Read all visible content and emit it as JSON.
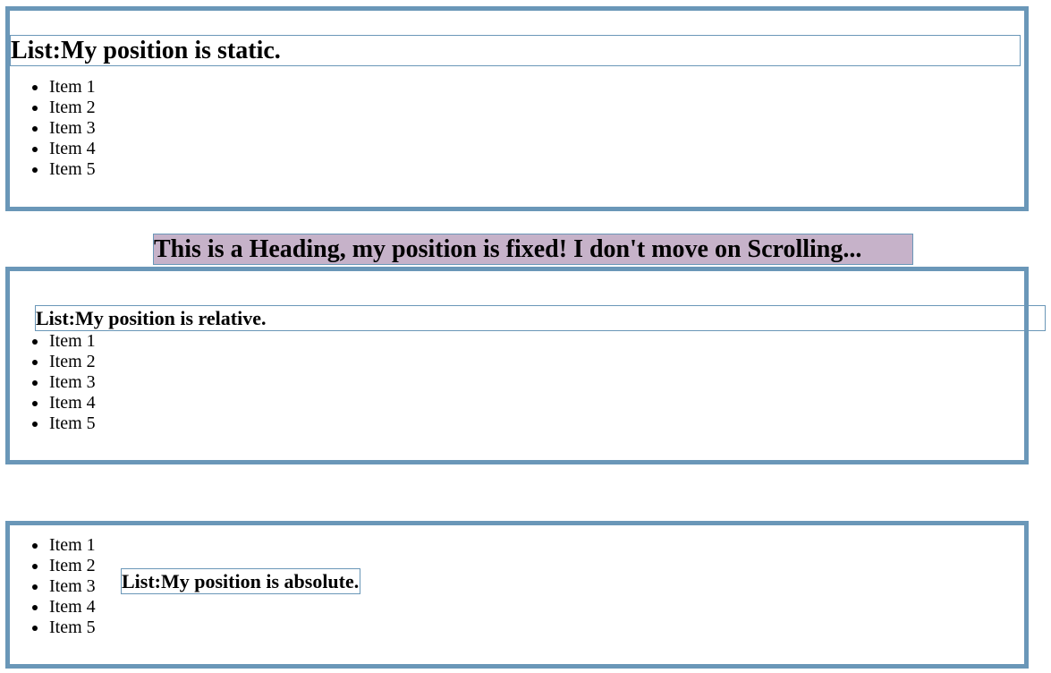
{
  "fixed_heading": "This is a Heading, my position is fixed! I don't move on Scrolling...",
  "sections": [
    {
      "heading": "List:My position is static.",
      "items": [
        "Item 1",
        "Item 2",
        "Item 3",
        "Item 4",
        "Item 5"
      ]
    },
    {
      "heading": "List:My position is relative.",
      "items": [
        "Item 1",
        "Item 2",
        "Item 3",
        "Item 4",
        "Item 5"
      ]
    },
    {
      "heading": "List:My position is absolute.",
      "items": [
        "Item 1",
        "Item 2",
        "Item 3",
        "Item 4",
        "Item 5"
      ]
    }
  ],
  "colors": {
    "border": "#6a97b8",
    "fixed_heading_background": "#c6b2c9"
  }
}
